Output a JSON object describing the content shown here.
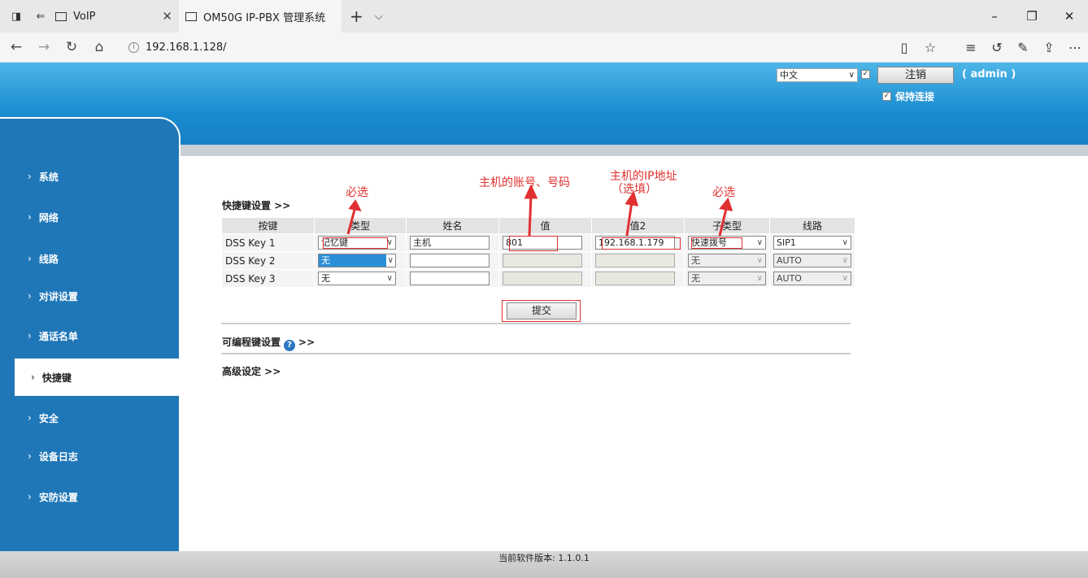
{
  "browser": {
    "tabs": [
      {
        "title": "VoIP"
      },
      {
        "title": "OM50G IP-PBX 管理系统"
      }
    ],
    "url": "192.168.1.128/"
  },
  "header": {
    "language": "中文",
    "logout_label": "注销",
    "user_label": "( admin )",
    "keep_connected_label": "保持连接"
  },
  "sidebar": {
    "items": [
      {
        "label": "系统"
      },
      {
        "label": "网络"
      },
      {
        "label": "线路"
      },
      {
        "label": "对讲设置"
      },
      {
        "label": "通话名单"
      },
      {
        "label": "快捷键"
      },
      {
        "label": "安全"
      },
      {
        "label": "设备日志"
      },
      {
        "label": "安防设置"
      }
    ],
    "active_index": 5
  },
  "main": {
    "section_title": "快捷键设置 >>",
    "table": {
      "headers": [
        "按键",
        "类型",
        "姓名",
        "值",
        "值2",
        "子类型",
        "线路"
      ],
      "rows": [
        {
          "key": "DSS Key 1",
          "type": "记忆键",
          "name": "主机",
          "value": "801",
          "value2": "192.168.1.179",
          "subtype": "快速拨号",
          "line": "SIP1"
        },
        {
          "key": "DSS Key 2",
          "type": "无",
          "name": "",
          "value": "",
          "value2": "",
          "subtype": "无",
          "line": "AUTO"
        },
        {
          "key": "DSS Key 3",
          "type": "无",
          "name": "",
          "value": "",
          "value2": "",
          "subtype": "无",
          "line": "AUTO"
        }
      ]
    },
    "submit_label": "提交",
    "programmable_title": "可编程键设置",
    "programmable_suffix": ">>",
    "advanced_title": "高级设定 >>"
  },
  "annotations": {
    "required_1": "必选",
    "account_number": "主机的账号、号码",
    "host_ip_line1": "主机的IP地址",
    "host_ip_line2": "（选填）",
    "required_2": "必选"
  },
  "footer": {
    "version_text": "当前软件版本: 1.1.0.1"
  },
  "colors": {
    "header_blue": "#1b8cd0",
    "sidebar_blue": "#1f77b8",
    "annotation_red": "#e03030"
  }
}
